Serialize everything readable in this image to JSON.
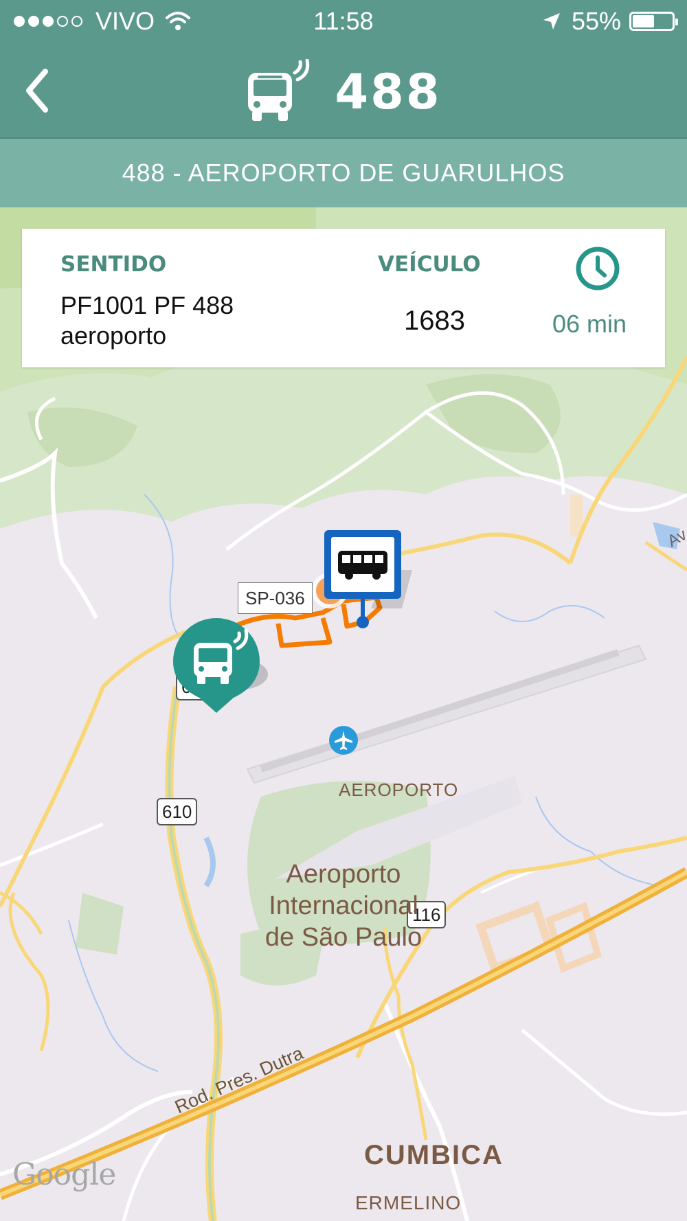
{
  "status_bar": {
    "carrier": "VIVO",
    "time": "11:58",
    "battery": "55%",
    "battery_level": 0.55,
    "signal_bars_filled": 3,
    "signal_bars_total": 5,
    "icons": [
      "wifi-icon",
      "location-arrow-icon",
      "battery-icon"
    ]
  },
  "header": {
    "back_icon": "chevron-left-icon",
    "route_icon": "live-bus-icon",
    "route_number": "488"
  },
  "subtitle": "488 - AEROPORTO DE GUARULHOS",
  "info_card": {
    "sentido_label": "SENTIDO",
    "sentido_line1": "PF1001 PF 488",
    "sentido_line2": "aeroporto",
    "veiculo_label": "VEÍCULO",
    "veiculo_value": "1683",
    "eta_icon": "clock-icon",
    "eta_value": "06 min"
  },
  "map": {
    "road_labels": {
      "sp036": "SP-036",
      "r610_top": "610",
      "r610": "610",
      "r116": "116",
      "dutra": "Rod. Pres. Dutra",
      "av": "Av"
    },
    "place_labels": {
      "aeroporto": "AEROPORTO",
      "airport_line1": "Aeroporto",
      "airport_line2": "Internacional",
      "airport_line3": "de São Paulo",
      "cumbica": "CUMBICA",
      "ermelino": "ERMELINO"
    },
    "attribution": "Google",
    "markers": [
      "bus-stop-icon",
      "bus-location-icon",
      "airport-icon"
    ],
    "colors": {
      "header": "#5c998d",
      "subtitle_bar": "#7ab2a5",
      "accent_text": "#4a8b7e",
      "route_line": "#f57c00",
      "stop_marker": "#1565c0",
      "bus_marker": "#26968a"
    }
  }
}
